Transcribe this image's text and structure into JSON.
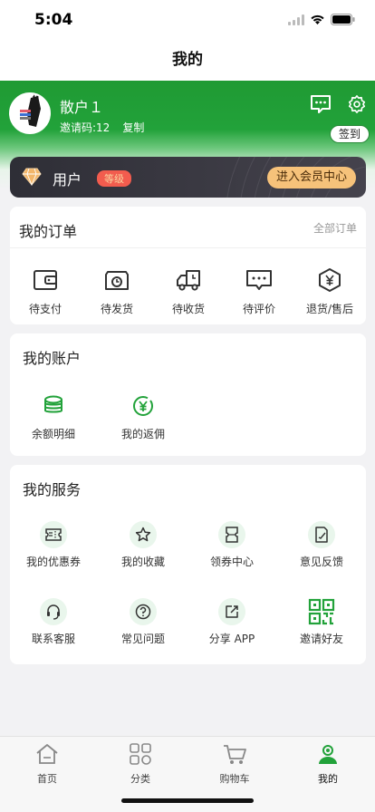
{
  "status_bar": {
    "time": "5:04"
  },
  "nav": {
    "title": "我的"
  },
  "profile": {
    "name": "散户１",
    "invite_code": "邀请码:12",
    "copy_label": "复制",
    "signin_label": "签到"
  },
  "vip": {
    "label": "用户",
    "level_badge": "等级",
    "button": "进入会员中心"
  },
  "orders": {
    "title": "我的订单",
    "all_link": "全部订单",
    "items": [
      {
        "label": "待支付",
        "icon": "wallet-icon"
      },
      {
        "label": "待发货",
        "icon": "clock-box-icon"
      },
      {
        "label": "待收货",
        "icon": "truck-icon"
      },
      {
        "label": "待评价",
        "icon": "comment-icon"
      },
      {
        "label": "退货/售后",
        "icon": "yen-shield-icon"
      }
    ]
  },
  "account": {
    "title": "我的账户",
    "items": [
      {
        "label": "余额明细",
        "icon": "coins-icon"
      },
      {
        "label": "我的返佣",
        "icon": "yen-circle-icon"
      }
    ]
  },
  "services": {
    "title": "我的服务",
    "items": [
      {
        "label": "我的优惠券",
        "icon": "coupon-icon"
      },
      {
        "label": "我的收藏",
        "icon": "star-icon"
      },
      {
        "label": "领券中心",
        "icon": "ticket-icon"
      },
      {
        "label": "意见反馈",
        "icon": "feedback-icon"
      },
      {
        "label": "联系客服",
        "icon": "headset-icon"
      },
      {
        "label": "常见问题",
        "icon": "question-icon"
      },
      {
        "label": "分享 APP",
        "icon": "share-icon"
      },
      {
        "label": "邀请好友",
        "icon": "qrcode-icon"
      }
    ]
  },
  "tabbar": {
    "items": [
      {
        "label": "首页",
        "icon": "home-icon"
      },
      {
        "label": "分类",
        "icon": "category-icon"
      },
      {
        "label": "购物车",
        "icon": "cart-icon"
      },
      {
        "label": "我的",
        "icon": "profile-icon"
      }
    ]
  },
  "colors": {
    "brand_green": "#22a23a",
    "vip_gold": "#f6c27a",
    "badge_red": "#f25c4e"
  }
}
